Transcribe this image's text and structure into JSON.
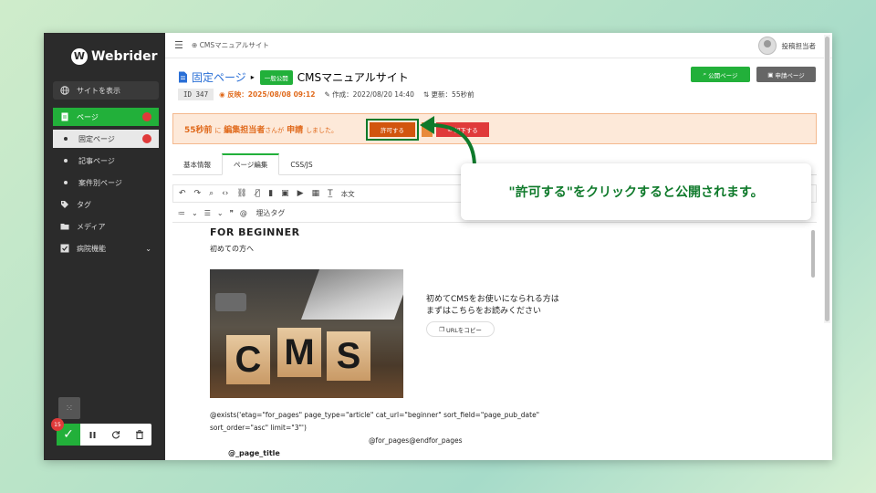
{
  "brand": {
    "name": "Webrider"
  },
  "sidebar": {
    "site_button": "サイトを表示",
    "items": [
      {
        "label": "ページ"
      },
      {
        "label": "固定ページ"
      },
      {
        "label": "記事ページ"
      },
      {
        "label": "案件別ページ"
      },
      {
        "label": "タグ"
      },
      {
        "label": "メディア"
      },
      {
        "label": "病院機能"
      }
    ],
    "badge_count": "15"
  },
  "topbar": {
    "breadcrumb": "CMSマニュアルサイト",
    "user": "投稿担当者"
  },
  "page": {
    "type_label": "固定ページ",
    "status_tag": "一般公開",
    "title": "CMSマニュアルサイト",
    "id": "ID 347",
    "reflect": "反映：2025/08/08 09:12",
    "created": "作成：2022/08/20 14:40",
    "updated": "更新：55秒前",
    "public_button": "公開ページ",
    "request_button": "申請ページ"
  },
  "banner": {
    "time": "55秒前",
    "mid1": "に",
    "editor": "編集担当者",
    "mid2": "さんが",
    "action": "申請",
    "tail": "しました。",
    "approve": "許可する",
    "reject": "却下する"
  },
  "tabs": [
    {
      "label": "基本情報"
    },
    {
      "label": "ページ編集"
    },
    {
      "label": "CSS/JS"
    }
  ],
  "toolbar": {
    "body_text": "本文",
    "embed_tag": "埋込タグ"
  },
  "content": {
    "heading": "FOR BEGINNER",
    "subheading": "初めての方へ",
    "cube_letters": [
      "C",
      "M",
      "S"
    ],
    "intro_line1": "初めてCMSをお使いになられる方は",
    "intro_line2": "まずはこちらをお読みください",
    "copy_button": "URLをコピー",
    "code_line1": "@exists('etag=\"for_pages\" page_type=\"article\" cat_url=\"beginner\" sort_field=\"page_pub_date\"",
    "code_line2": "sort_order=\"asc\" limit=\"3\"')",
    "code_line3": "@for_pages@endfor_pages",
    "code_line4": "@_page_title"
  },
  "callout": {
    "text": "\"許可する\"をクリックすると公開されます。"
  },
  "colors": {
    "accent_green": "#22b03a",
    "orange": "#e06a1c",
    "danger": "#e03a3a",
    "sidebar_bg": "#2b2b2b"
  }
}
